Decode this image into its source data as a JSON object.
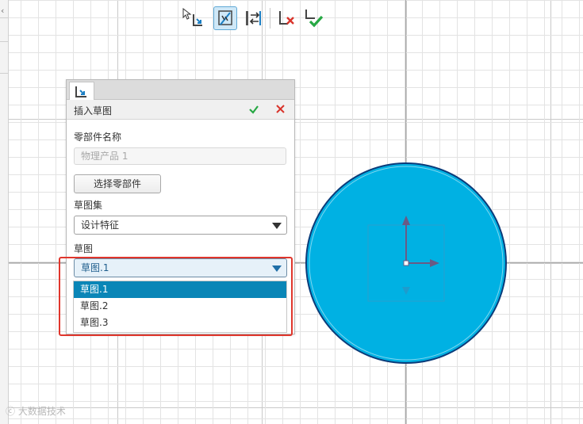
{
  "toolbar": {
    "tools": [
      {
        "name": "select-arrow-icon"
      },
      {
        "name": "insert-sketch-icon",
        "active": true
      },
      {
        "name": "reference-switch-icon"
      },
      {
        "name": "cancel-icon"
      },
      {
        "name": "confirm-icon"
      }
    ]
  },
  "dialog": {
    "title": "插入草图",
    "component_label": "零部件名称",
    "component_value": "物理产品 1",
    "select_button": "选择零部件",
    "sketch_set_label": "草图集",
    "sketch_set_value": "设计特征",
    "sketch_label": "草图",
    "sketch_value": "草图.1",
    "sketch_options": [
      "草图.1",
      "草图.2",
      "草图.3"
    ],
    "selected_index": 0
  },
  "watermark": "大数据技术",
  "colors": {
    "accent": "#0a86b7",
    "circle_fill": "#00b1e3",
    "circle_stroke": "#0b3c7a",
    "highlight": "#e0362c",
    "ok": "#27a844",
    "cancel": "#d9342b",
    "axis_arrow": "#6a5a85"
  }
}
